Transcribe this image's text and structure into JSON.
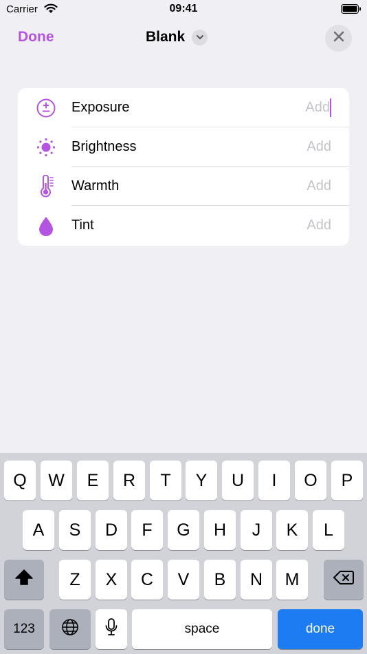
{
  "status_bar": {
    "carrier": "Carrier",
    "time": "09:41",
    "wifi_icon": "wifi-icon",
    "battery_icon": "battery-icon"
  },
  "nav": {
    "done_label": "Done",
    "title": "Blank",
    "title_chevron_icon": "chevron-down-icon",
    "close_icon": "close-icon"
  },
  "adjustments": {
    "rows": [
      {
        "label": "Exposure",
        "placeholder": "Add",
        "icon": "exposure-icon",
        "focused": true
      },
      {
        "label": "Brightness",
        "placeholder": "Add",
        "icon": "brightness-icon",
        "focused": false
      },
      {
        "label": "Warmth",
        "placeholder": "Add",
        "icon": "thermometer-icon",
        "focused": false
      },
      {
        "label": "Tint",
        "placeholder": "Add",
        "icon": "drop-icon",
        "focused": false
      }
    ]
  },
  "keyboard": {
    "row1": [
      "Q",
      "W",
      "E",
      "R",
      "T",
      "Y",
      "U",
      "I",
      "O",
      "P"
    ],
    "row2": [
      "A",
      "S",
      "D",
      "F",
      "G",
      "H",
      "J",
      "K",
      "L"
    ],
    "row3": [
      "Z",
      "X",
      "C",
      "V",
      "B",
      "N",
      "M"
    ],
    "numbers_label": "123",
    "space_label": "space",
    "done_label": "done",
    "shift_icon": "shift-icon",
    "delete_icon": "delete-icon",
    "globe_icon": "globe-icon",
    "mic_icon": "microphone-icon"
  },
  "colors": {
    "accent": "#b454e3",
    "placeholder": "#c4c4c8",
    "done_key": "#1d7cf2",
    "background": "#efeff4"
  }
}
